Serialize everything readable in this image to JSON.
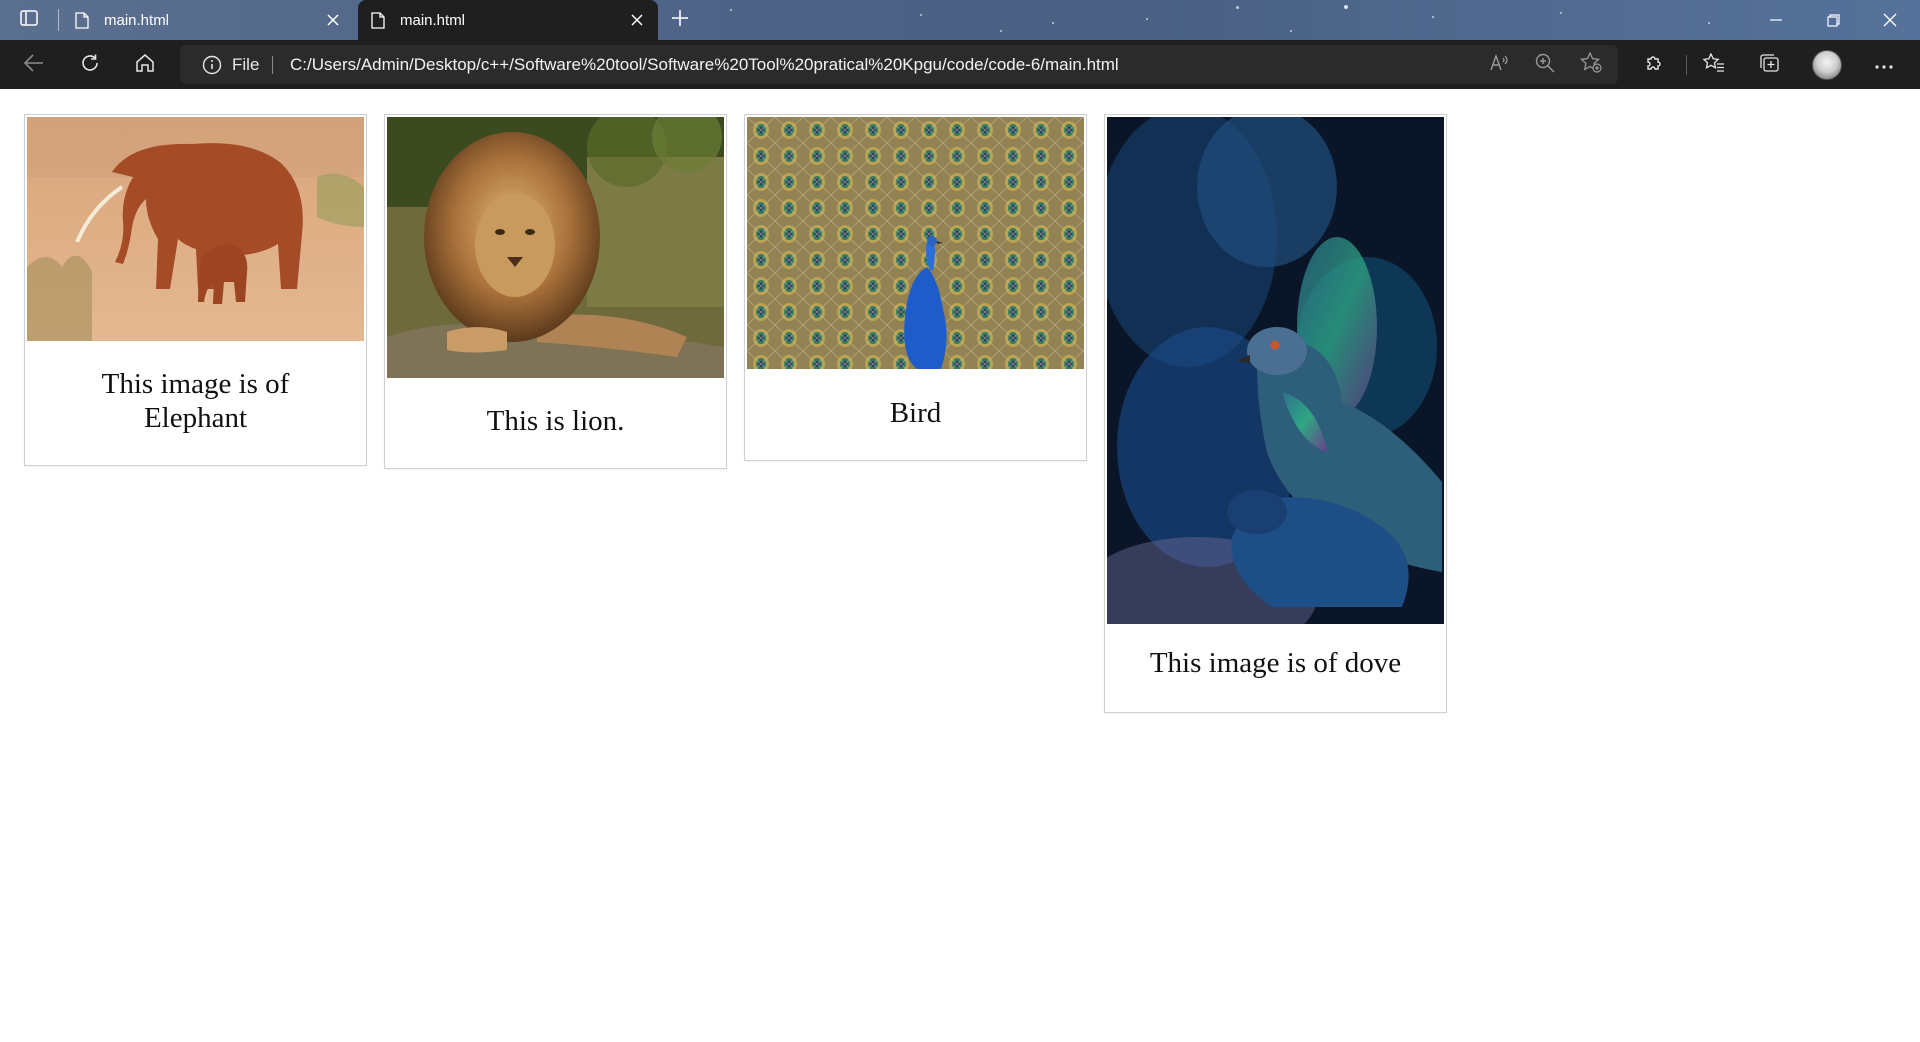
{
  "browser": {
    "tabs": [
      {
        "title": "main.html",
        "active": false
      },
      {
        "title": "main.html",
        "active": true
      }
    ],
    "site_info_label": "File",
    "url": "C:/Users/Admin/Desktop/c++/Software%20tool/Software%20Tool%20pratical%20Kpgu/code/code-6/main.html",
    "toolbar_icons": [
      "back-icon",
      "refresh-icon",
      "home-icon",
      "read-aloud-icon",
      "zoom-icon",
      "add-favorite-icon",
      "extensions-icon",
      "favorites-icon",
      "collections-icon",
      "profile-avatar",
      "more-icon"
    ],
    "accent_colors": {
      "titlebar": "#4f6486",
      "toolbar": "#1f1f1f",
      "omnibox": "#2b2b2b"
    }
  },
  "cards": [
    {
      "caption_line1": "This image is of",
      "caption_line2": "Elephant",
      "image": "elephant-photo"
    },
    {
      "caption": "This is lion.",
      "image": "lion-photo"
    },
    {
      "caption": "Bird",
      "image": "peacock-photo"
    },
    {
      "caption": "This image is of dove",
      "image": "pigeon-photo"
    }
  ]
}
